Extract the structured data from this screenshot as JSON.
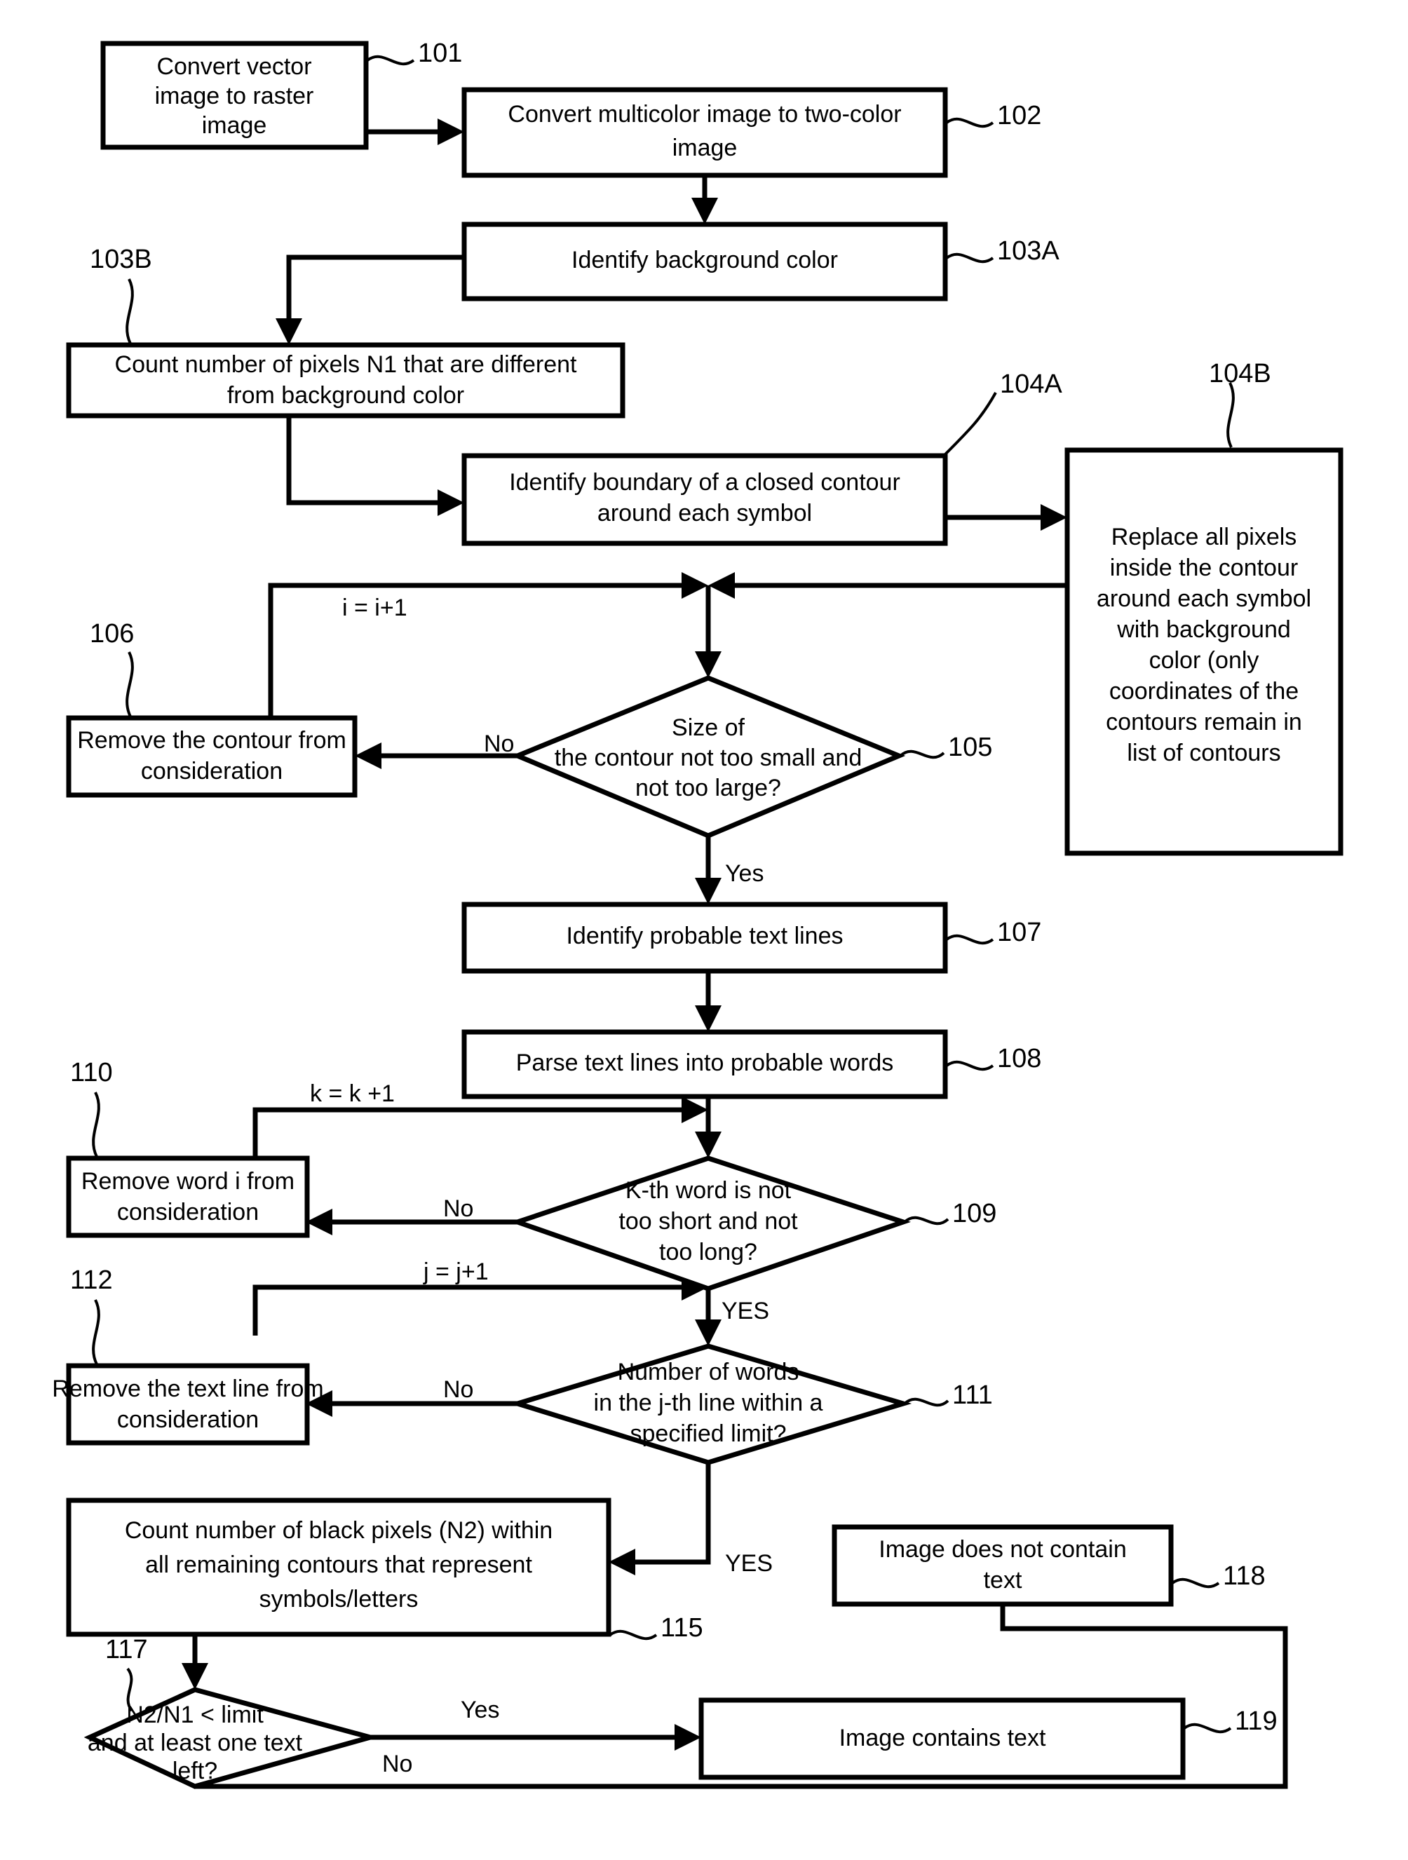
{
  "diagram": {
    "title": "Text detection in image flowchart",
    "type": "flowchart",
    "ink_color": "#000000",
    "background_color": "#ffffff"
  },
  "nodes": {
    "n101": {
      "ref": "101",
      "shape": "process",
      "lines": [
        "Convert vector",
        "image to raster",
        "image"
      ]
    },
    "n102": {
      "ref": "102",
      "shape": "process",
      "lines": [
        "Convert multicolor image to two-color",
        "image"
      ]
    },
    "n103a": {
      "ref": "103A",
      "shape": "process",
      "lines": [
        "Identify background color"
      ]
    },
    "n103b": {
      "ref": "103B",
      "shape": "process",
      "lines": [
        "Count number of pixels N1 that are different",
        "from background color"
      ]
    },
    "n104a": {
      "ref": "104A",
      "shape": "process",
      "lines": [
        "Identify boundary of a closed contour",
        "around each symbol"
      ]
    },
    "n104b": {
      "ref": "104B",
      "shape": "process",
      "lines": [
        "Replace all pixels",
        "inside the contour",
        "around each symbol",
        "with background",
        "color (only",
        "coordinates of the",
        "contours remain in",
        "list of contours"
      ]
    },
    "n105": {
      "ref": "105",
      "shape": "decision",
      "lines": [
        "Size of",
        "the contour not too small and",
        "not too large?"
      ]
    },
    "n106": {
      "ref": "106",
      "shape": "process",
      "lines": [
        "Remove the contour from",
        "consideration"
      ]
    },
    "n107": {
      "ref": "107",
      "shape": "process",
      "lines": [
        "Identify probable text lines"
      ]
    },
    "n108": {
      "ref": "108",
      "shape": "process",
      "lines": [
        "Parse text lines into probable words"
      ]
    },
    "n109": {
      "ref": "109",
      "shape": "decision",
      "lines": [
        "K-th word is not",
        "too short and not",
        "too long?"
      ]
    },
    "n110": {
      "ref": "110",
      "shape": "process",
      "lines": [
        "Remove word i from",
        "consideration"
      ]
    },
    "n111": {
      "ref": "111",
      "shape": "decision",
      "lines": [
        "Number of words",
        "in the j-th line within a",
        "specified limit?"
      ]
    },
    "n112": {
      "ref": "112",
      "shape": "process",
      "lines": [
        "Remove the text line from",
        "consideration"
      ]
    },
    "n115": {
      "ref": "115",
      "shape": "process",
      "lines": [
        "Count number of black pixels (N2) within",
        "all remaining contours that represent",
        "symbols/letters"
      ]
    },
    "n117": {
      "ref": "117",
      "shape": "decision",
      "lines": [
        "N2/N1 < limit",
        "and at least one text",
        "left?"
      ]
    },
    "n118": {
      "ref": "118",
      "shape": "process",
      "lines": [
        "Image does not contain",
        "text"
      ]
    },
    "n119": {
      "ref": "119",
      "shape": "process",
      "lines": [
        "Image contains text"
      ]
    }
  },
  "edge_labels": {
    "loop_i": "i = i+1",
    "no_105": "No",
    "yes_105": "Yes",
    "loop_k": "k = k +1",
    "no_109": "No",
    "yes_109": "YES",
    "loop_j": "j = j+1",
    "no_111": "No",
    "yes_111": "YES",
    "yes_117": "Yes",
    "no_117": "No"
  }
}
